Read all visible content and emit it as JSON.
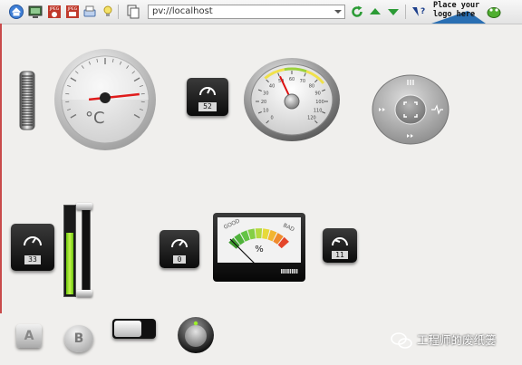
{
  "toolbar": {
    "address": "pv://localhost",
    "logo_text": "Place your\nlogo here",
    "icons": [
      "home-icon",
      "screen-icon",
      "camera-icon",
      "image-icon",
      "print-icon",
      "lightbulb-icon",
      "copy-icon",
      "refresh-icon",
      "up-arrow-icon",
      "down-arrow-icon",
      "help-icon",
      "frog-icon"
    ]
  },
  "thermometer": {
    "unit": "°C",
    "value": 8.5,
    "min": 0,
    "max": 10
  },
  "speed_gauge": {
    "tick_labels": [
      "0",
      "10",
      "20",
      "30",
      "40",
      "50",
      "60",
      "70",
      "80",
      "90",
      "100",
      "110",
      "120"
    ],
    "value": 50,
    "min": 0,
    "max": 120
  },
  "digital_gauges": [
    {
      "value": "52"
    },
    {
      "value": "33"
    },
    {
      "value": "0"
    },
    {
      "value": "11"
    }
  ],
  "vu_meter": {
    "label_good": "GOOD",
    "label_bad": "BAD",
    "unit": "%",
    "value": 0
  },
  "buttons": {
    "a": "A",
    "b": "B"
  },
  "watermark": "工程师的废纸篓"
}
